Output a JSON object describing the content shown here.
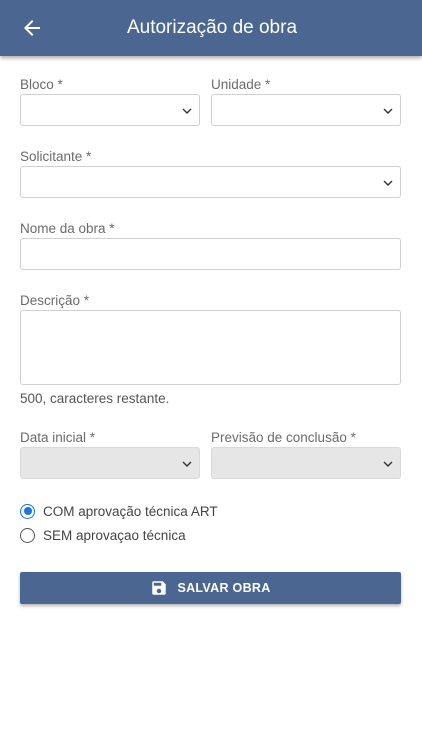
{
  "appbar": {
    "title": "Autorização de obra",
    "back_icon": "arrow-left-icon",
    "background_color": "#4a6691"
  },
  "form": {
    "bloco_label": "Bloco *",
    "unidade_label": "Unidade *",
    "solicitante_label": "Solicitante *",
    "nome_label": "Nome da obra *",
    "descricao_label": "Descrição *",
    "counter_text": "500, caracteres restante.",
    "data_inicial_label": "Data inicial *",
    "previsao_label": "Previsão de conclusão *",
    "radio_options": [
      {
        "label": "COM aprovação técnica ART",
        "checked": true
      },
      {
        "label": "SEM aprovaçao técnica",
        "checked": false
      }
    ],
    "accent_color": "#1a73e8"
  },
  "save_button": {
    "label": "SALVAR OBRA",
    "icon": "floppy-disk-icon"
  }
}
